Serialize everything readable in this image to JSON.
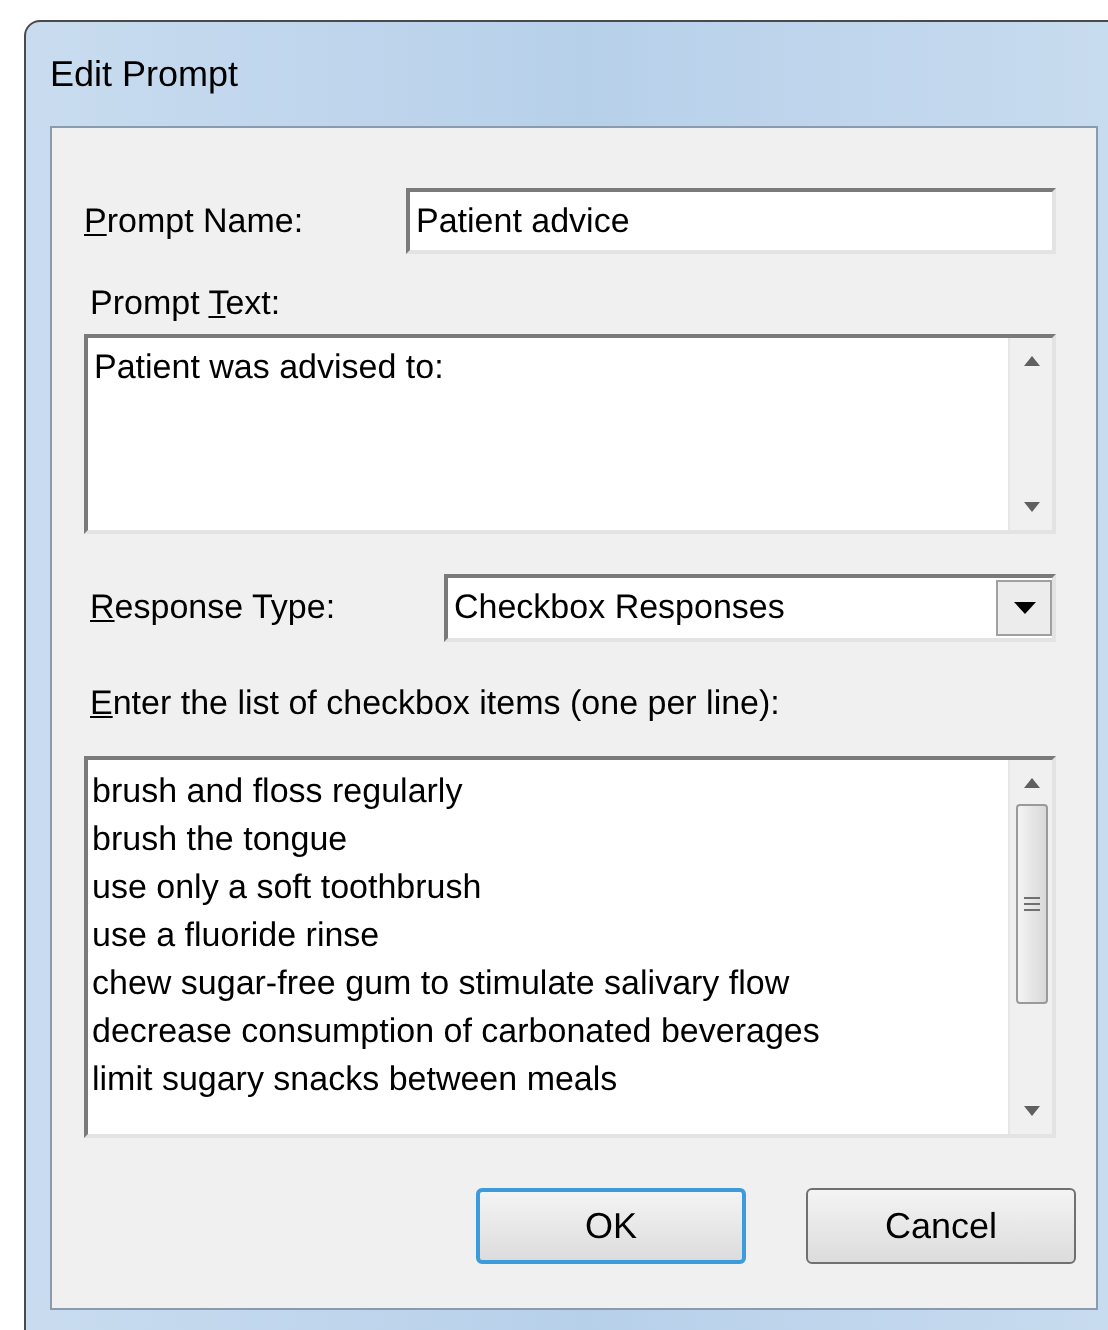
{
  "window": {
    "title": "Edit Prompt"
  },
  "prompt_name": {
    "label": {
      "key": "P",
      "after": "rompt Name:"
    },
    "value": "Patient advice"
  },
  "prompt_text": {
    "label": {
      "before": "Prompt ",
      "key": "T",
      "after": "ext:"
    },
    "value": "Patient was advised to:"
  },
  "response_type": {
    "label": {
      "key": "R",
      "after": "esponse Type:"
    },
    "value": "Checkbox Responses"
  },
  "items_list": {
    "label": {
      "key": "E",
      "after": "nter the list of checkbox items (one per line):"
    },
    "lines": [
      "brush and floss regularly",
      "brush the tongue",
      "use only a soft toothbrush",
      "use a fluoride rinse",
      "chew sugar-free gum to stimulate salivary flow",
      "decrease consumption of carbonated beverages",
      "limit sugary snacks between meals"
    ]
  },
  "buttons": [
    {
      "label": "OK",
      "default": true
    },
    {
      "label": "Cancel",
      "default": false
    }
  ]
}
